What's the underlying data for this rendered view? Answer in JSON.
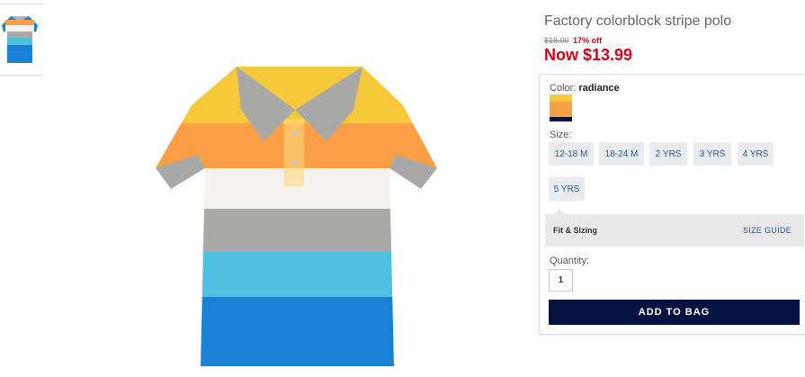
{
  "product": {
    "title": "Factory colorblock stripe polo",
    "old_price": "$18.00",
    "discount": "17% off",
    "now_price": "Now $13.99"
  },
  "color": {
    "label": "Color:",
    "value": "radiance"
  },
  "size": {
    "label": "Size:",
    "options": [
      "12-18 M",
      "18-24 M",
      "2 YRS",
      "3 YRS",
      "4 YRS",
      "5 YRS"
    ]
  },
  "fit": {
    "title": "Fit & Sizing",
    "guide_link": "SIZE GUIDE"
  },
  "quantity": {
    "label": "Quantity:",
    "value": "1"
  },
  "actions": {
    "add_to_bag": "ADD TO BAG"
  },
  "colors": {
    "price_red": "#d0021b",
    "link_blue": "#2c5aa0",
    "cta_navy": "#031141",
    "stripes": [
      "#f5c93a",
      "#fb9f46",
      "#f3f2ee",
      "#a9a9a7",
      "#4fc0e2",
      "#1a82d6"
    ]
  }
}
